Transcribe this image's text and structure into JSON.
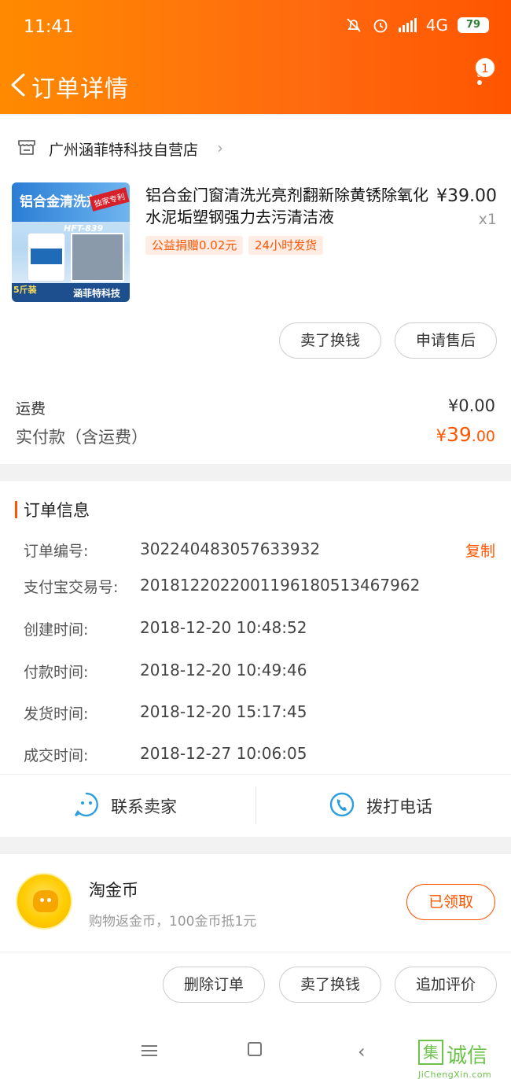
{
  "status_bar": {
    "time": "11:41",
    "network": "4G",
    "battery": "79"
  },
  "nav": {
    "title": "订单详情",
    "badge_count": "1"
  },
  "shop": {
    "name": "广州涵菲特科技自营店"
  },
  "product": {
    "image_text": {
      "title": "铝合金清洗剂",
      "tag": "独家专利",
      "model": "HFT-839",
      "size": "5斤装",
      "brand": "涵菲特科技"
    },
    "title": "铝合金门窗清洗光亮剂翻新除黄锈除氧化水泥垢塑钢强力去污清洁液",
    "price": "¥39.00",
    "quantity": "x1",
    "tags": [
      "公益捐赠0.02元",
      "24小时发货"
    ]
  },
  "item_actions": {
    "sell": "卖了换钱",
    "after_sale": "申请售后"
  },
  "fees": {
    "shipping_label": "运费",
    "shipping_value": "¥0.00",
    "paid_label": "实付款（含运费）",
    "paid_currency": "¥",
    "paid_integer": "39",
    "paid_decimal": ".00"
  },
  "order_info": {
    "title": "订单信息",
    "copy_label": "复制",
    "rows": [
      {
        "label": "订单编号:",
        "value": "302240483057633932"
      },
      {
        "label": "支付宝交易号:",
        "value": "2018122022001196180513467962"
      },
      {
        "label": "创建时间:",
        "value": "2018-12-20 10:48:52"
      },
      {
        "label": "付款时间:",
        "value": "2018-12-20 10:49:46"
      },
      {
        "label": "发货时间:",
        "value": "2018-12-20 15:17:45"
      },
      {
        "label": "成交时间:",
        "value": "2018-12-27 10:06:05"
      }
    ]
  },
  "contact": {
    "seller": "联系卖家",
    "call": "拨打电话"
  },
  "coins": {
    "title": "淘金币",
    "desc": "购物返金币，100金币抵1元",
    "button": "已领取"
  },
  "bottom_actions": {
    "delete": "删除订单",
    "sell": "卖了换钱",
    "review": "追加评价"
  },
  "watermark": {
    "mark": "集",
    "chars": "诚信",
    "url": "JiChengXin.com"
  },
  "colors": {
    "accent": "#ff5500",
    "header_start": "#ff8a00",
    "header_end": "#ff5500"
  }
}
